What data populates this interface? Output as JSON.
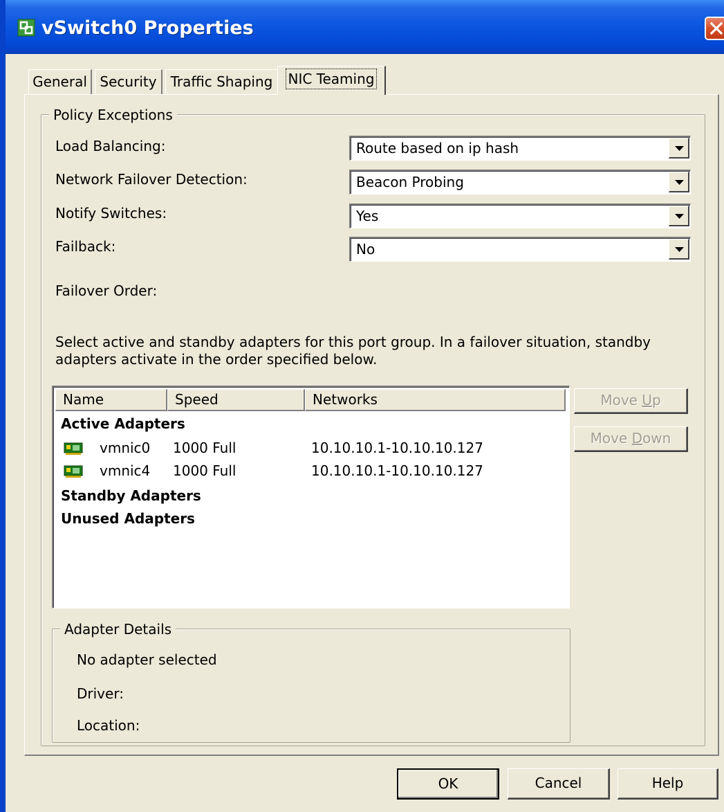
{
  "window": {
    "title": "vSwitch0 Properties"
  },
  "tabs": [
    {
      "label": "General"
    },
    {
      "label": "Security"
    },
    {
      "label": "Traffic Shaping"
    },
    {
      "label": "NIC Teaming"
    }
  ],
  "policy_exceptions": {
    "legend": "Policy Exceptions",
    "load_balancing": {
      "label": "Load Balancing:",
      "value": "Route based on ip hash"
    },
    "failover_detection": {
      "label": "Network Failover Detection:",
      "value": "Beacon Probing"
    },
    "notify_switches": {
      "label": "Notify Switches:",
      "value": "Yes"
    },
    "failback": {
      "label": "Failback:",
      "value": "No"
    },
    "failover_order_label": "Failover Order:",
    "description_line1": "Select active and standby adapters for this port group.  In a failover situation, standby",
    "description_line2": "adapters activate  in the order specified below."
  },
  "adapter_list": {
    "columns": [
      "Name",
      "Speed",
      "Networks"
    ],
    "active_heading": "Active Adapters",
    "standby_heading": "Standby Adapters",
    "unused_heading": "Unused Adapters",
    "rows": [
      {
        "name": "vmnic0",
        "speed": "1000 Full",
        "networks": "10.10.10.1-10.10.10.127"
      },
      {
        "name": "vmnic4",
        "speed": "1000 Full",
        "networks": "10.10.10.1-10.10.10.127"
      }
    ]
  },
  "move_buttons": {
    "up_prefix": "Move ",
    "up_key": "U",
    "up_suffix": "p",
    "down_prefix": "Move ",
    "down_key": "D",
    "down_suffix": "own"
  },
  "adapter_details": {
    "legend": "Adapter Details",
    "status": "No adapter selected",
    "driver_label": "Driver:",
    "location_label": "Location:"
  },
  "footer": {
    "ok": "OK",
    "cancel": "Cancel",
    "help": "Help"
  },
  "icons": {
    "app": "vsphere-network-icon",
    "close": "close-icon",
    "adapter": "network-card-icon",
    "dropdown": "chevron-down-icon"
  },
  "colors": {
    "titlebar": "#0a55e0",
    "window_bg": "#ece9d8",
    "close_button": "#d54c25"
  }
}
